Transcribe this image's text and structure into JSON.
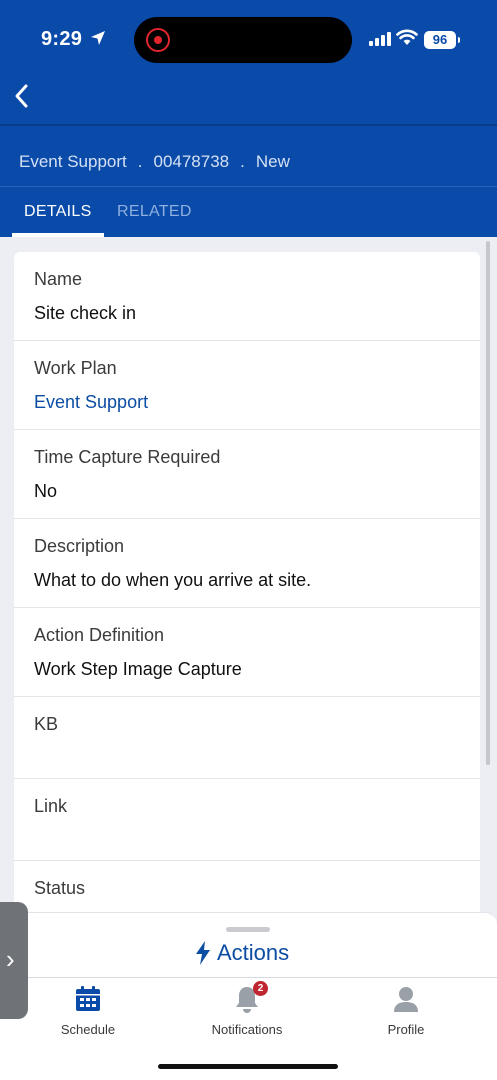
{
  "status_bar": {
    "time": "9:29",
    "battery": "96"
  },
  "header": {
    "breadcrumb": [
      "Event Support",
      "00478738",
      "New"
    ],
    "separator": ".",
    "tabs": [
      {
        "label": "DETAILS",
        "active": true
      },
      {
        "label": "RELATED",
        "active": false
      }
    ]
  },
  "fields": [
    {
      "label": "Name",
      "value": "Site check in",
      "is_link": false
    },
    {
      "label": "Work Plan",
      "value": "Event Support",
      "is_link": true
    },
    {
      "label": "Time Capture Required",
      "value": "No",
      "is_link": false
    },
    {
      "label": "Description",
      "value": "What to do when you arrive at site.",
      "is_link": false
    },
    {
      "label": "Action Definition",
      "value": "Work Step Image Capture",
      "is_link": false
    },
    {
      "label": "KB",
      "value": "",
      "is_link": false
    },
    {
      "label": "Link",
      "value": "",
      "is_link": false
    },
    {
      "label": "Status",
      "value": "",
      "is_link": false
    }
  ],
  "actions": {
    "label": "Actions",
    "icon": "lightning-bolt-icon"
  },
  "tabbar": [
    {
      "label": "Schedule",
      "icon": "calendar-icon"
    },
    {
      "label": "Notifications",
      "icon": "bell-icon",
      "badge": "2"
    },
    {
      "label": "Profile",
      "icon": "person-icon"
    }
  ],
  "side_handle": {
    "glyph": "›"
  },
  "colors": {
    "brand": "#0a4aa8",
    "link": "#0b4da3",
    "badge": "#c0262f"
  }
}
